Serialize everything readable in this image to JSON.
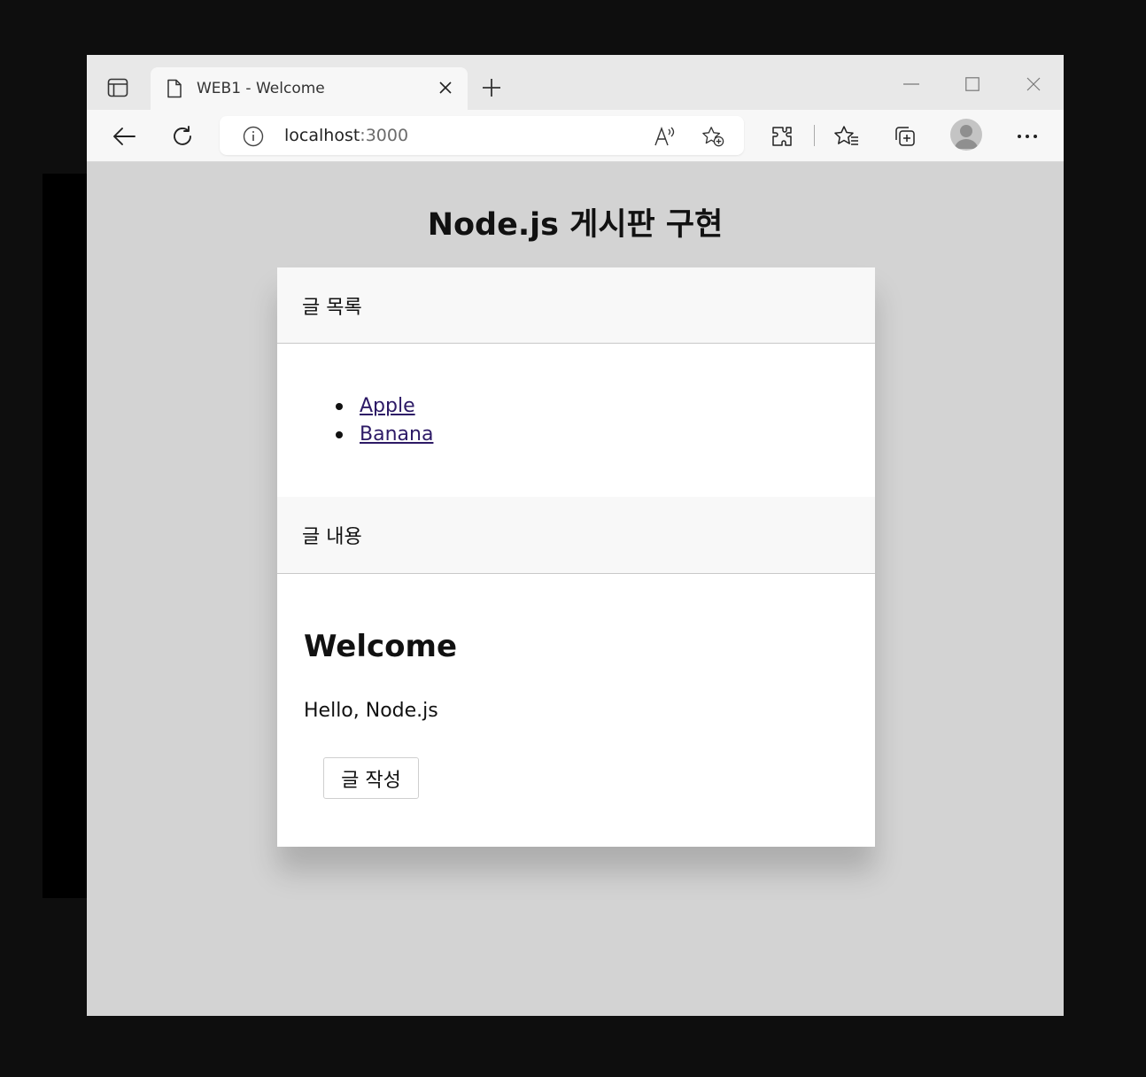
{
  "browser": {
    "tab": {
      "title": "WEB1 - Welcome"
    },
    "address": {
      "host": "localhost",
      "port": ":3000"
    }
  },
  "page": {
    "heading": "Node.js 게시판 구현",
    "list_section": {
      "header": "글 목록",
      "items": [
        "Apple",
        "Banana"
      ]
    },
    "content_section": {
      "header": "글 내용",
      "title": "Welcome",
      "body": "Hello, Node.js",
      "write_button": "글 작성"
    }
  }
}
